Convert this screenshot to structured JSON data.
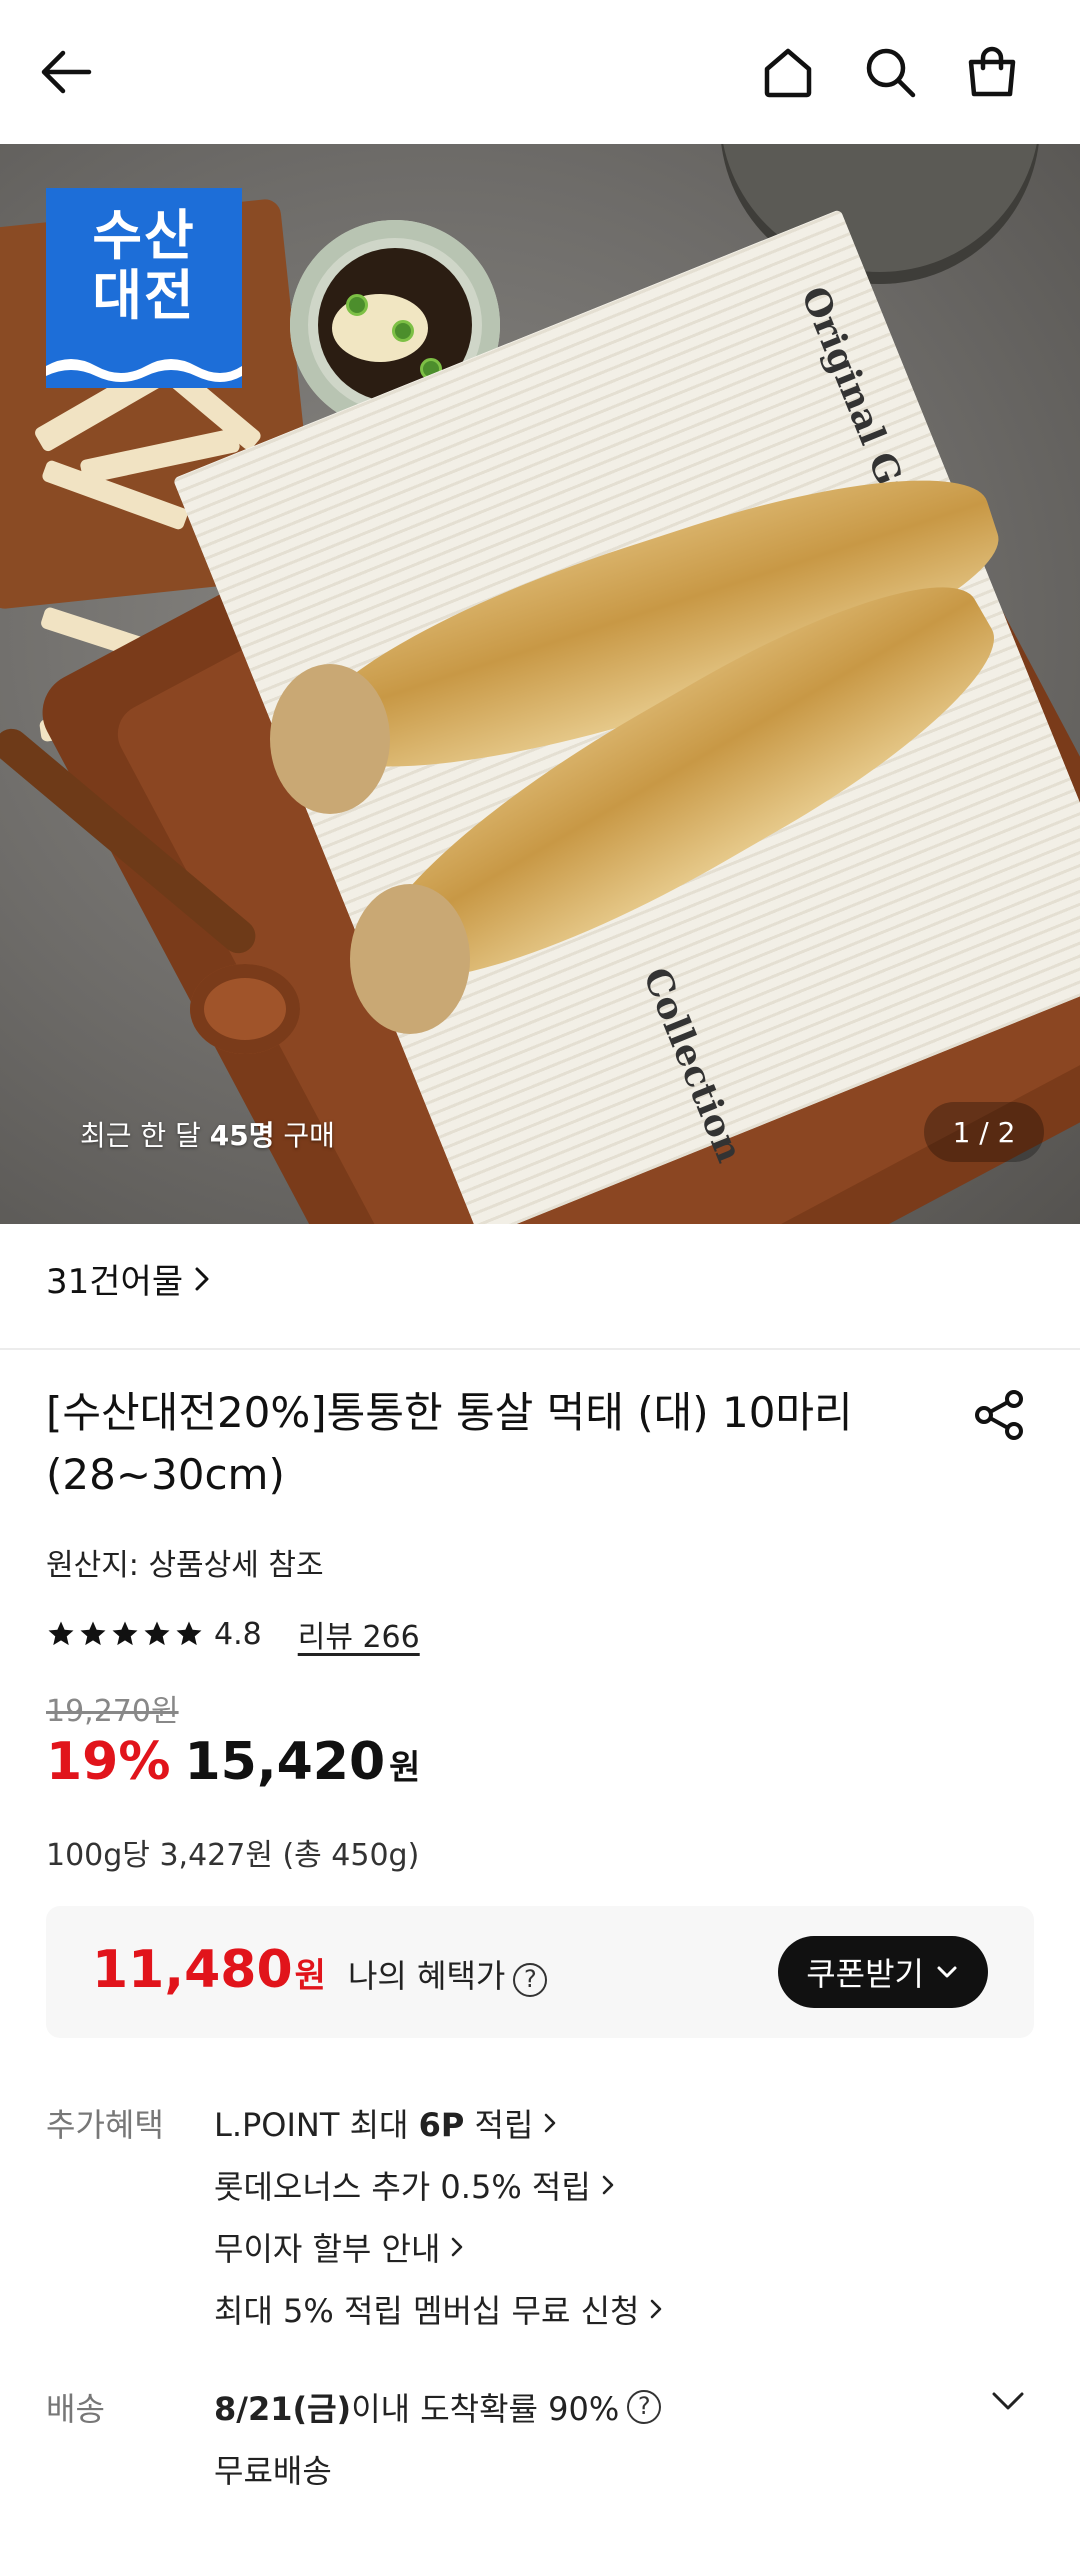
{
  "header": {
    "back_icon": "arrow-left-icon",
    "home_icon": "home-icon",
    "search_icon": "search-icon",
    "cart_icon": "shopping-bag-icon"
  },
  "hero": {
    "badge_line1": "수산",
    "badge_line2": "대전",
    "badge_color": "#1d6ed8",
    "buyers_prefix": "최근 한 달 ",
    "buyers_count": "45명",
    "buyers_suffix": " 구매",
    "pager": "1 / 2",
    "paper_text1": "Original Graphics",
    "paper_text2": "Collection"
  },
  "seller": {
    "name": "31건어물"
  },
  "product": {
    "title": "[수산대전20%]통통한 통살 먹태 (대) 10마리 (28~30cm)",
    "origin": "원산지: 상품상세 참조",
    "rating": "4.8",
    "stars": 5,
    "review_label": "리뷰 266",
    "original_price": "19,270원",
    "discount": "19%",
    "price": "15,420",
    "price_unit": "원",
    "unit_price": "100g당 3,427원 (총 450g)"
  },
  "benefit_box": {
    "price": "11,480",
    "price_unit": "원",
    "label": "나의 혜택가",
    "help_icon": "question-circle-icon",
    "coupon_label": "쿠폰받기"
  },
  "extra_benefits": {
    "label": "추가혜택",
    "items": [
      {
        "prefix": "L.POINT 최대 ",
        "bold": "6P",
        "suffix": " 적립"
      },
      {
        "text": "롯데오너스 추가 0.5% 적립"
      },
      {
        "text": "무이자 할부 안내"
      },
      {
        "text": "최대 5% 적립 멤버십 무료 신청"
      }
    ]
  },
  "delivery": {
    "label": "배송",
    "date": "8/21(금)",
    "date_suffix": " 이내 도착확률 90%",
    "free": "무료배송"
  },
  "colors": {
    "accent_red": "#e1141b",
    "text": "#111111",
    "muted": "#777777"
  }
}
